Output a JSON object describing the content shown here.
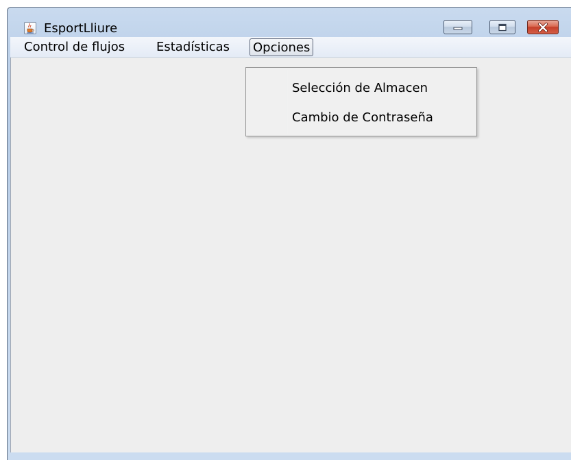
{
  "window": {
    "title": "EsportLliure",
    "app_icon": "java-cup-icon",
    "controls": {
      "minimize": "minimize-icon",
      "maximize": "maximize-icon",
      "close": "close-icon"
    }
  },
  "menubar": {
    "items": [
      {
        "label": "Control de flujos"
      },
      {
        "label": "Estadísticas"
      },
      {
        "label": "Opciones",
        "active": true
      }
    ]
  },
  "opciones_menu": {
    "items": [
      {
        "label": "Selección de Almacen"
      },
      {
        "label": "Cambio de Contraseña"
      }
    ]
  },
  "colors": {
    "close_button": "#c5402a",
    "content_background": "#eeeeee",
    "frame": "#bed2ea"
  }
}
